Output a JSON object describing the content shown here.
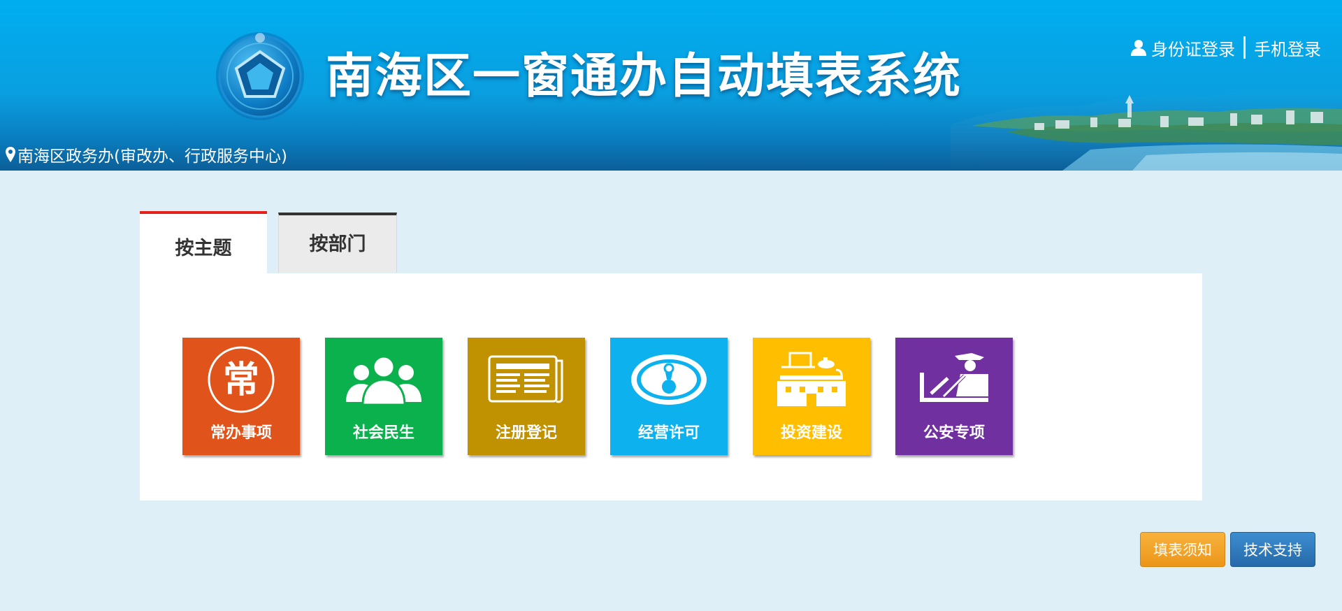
{
  "header": {
    "title": "南海区一窗通办自动填表系统",
    "login": {
      "id_card_login": "身份证登录",
      "phone_login": "手机登录"
    },
    "location": "南海区政务办(审改办、行政服务中心)",
    "icons": [
      "logo-emblem",
      "user-icon",
      "map-pin-icon"
    ]
  },
  "tabs": [
    {
      "label": "按主题",
      "active": true
    },
    {
      "label": "按部门",
      "active": false
    }
  ],
  "tiles": [
    {
      "label": "常办事项",
      "icon": "chang-icon",
      "glyph": "常",
      "color": "#e0531a"
    },
    {
      "label": "社会民生",
      "icon": "people-icon",
      "color": "#0ab14c"
    },
    {
      "label": "注册登记",
      "icon": "newspaper-icon",
      "color": "#c09100"
    },
    {
      "label": "经营许可",
      "icon": "license-icon",
      "color": "#0db1ee"
    },
    {
      "label": "投资建设",
      "icon": "building-icon",
      "color": "#ffbf00"
    },
    {
      "label": "公安专项",
      "icon": "police-icon",
      "color": "#7030a0"
    }
  ],
  "buttons": {
    "notice": "填表须知",
    "support": "技术支持"
  },
  "colors": {
    "header_blue": "#00aef0",
    "page_bg": "#dfeff7",
    "active_tab_border": "#e4211b",
    "inactive_tab_border": "#333333"
  }
}
